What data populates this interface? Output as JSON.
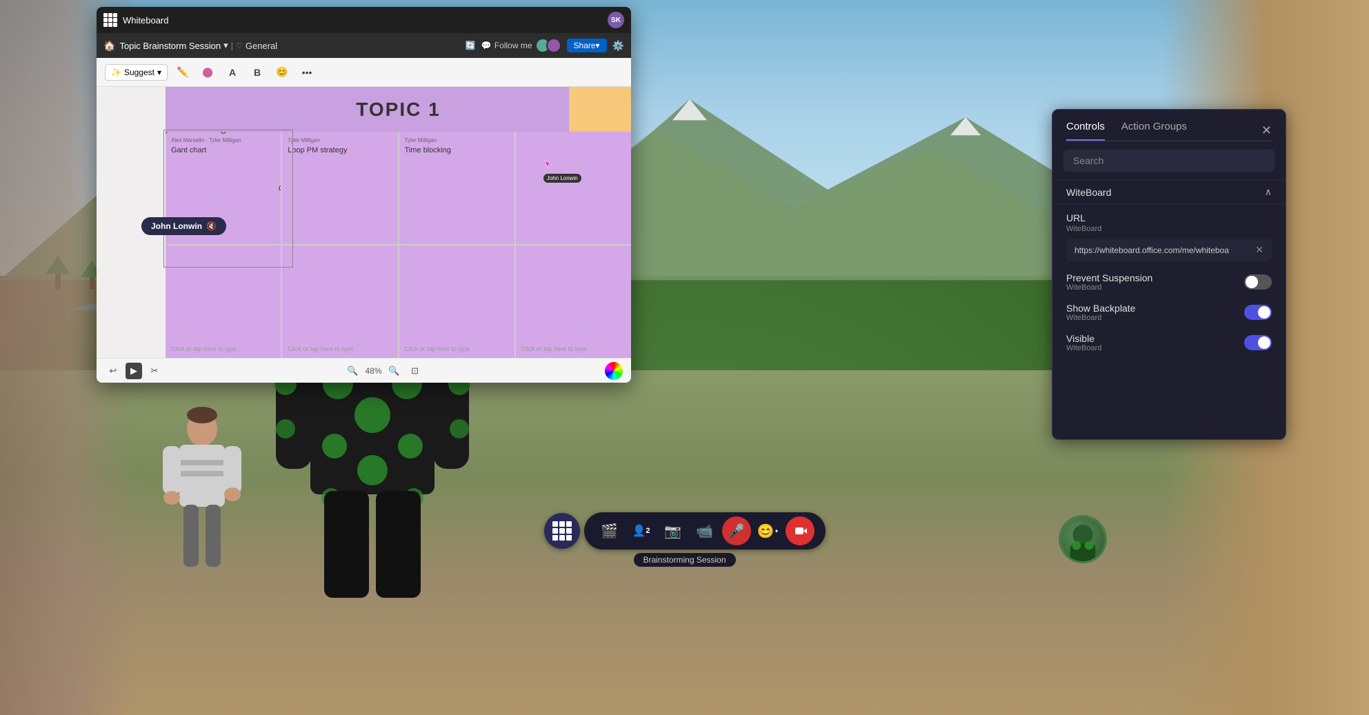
{
  "app": {
    "title": "Whiteboard"
  },
  "whiteboard": {
    "title": "Topic Brainstorm Session",
    "breadcrumb_home": "🏠",
    "breadcrumb_name": "Topic Brainstorm Session",
    "breadcrumb_channel": "General",
    "follow_label": "Follow me",
    "share_label": "Share▾",
    "sk_badge": "SK",
    "topic_title": "TOPIC 1",
    "zoom_level": "48%",
    "toolbar": {
      "suggest_label": "Suggest",
      "tools": [
        "✏️",
        "⬤",
        "A",
        "B",
        "😊",
        "•••"
      ]
    },
    "stickies": [
      {
        "author": "Alex Marsello · Tyler Milligan",
        "content": "Gant chart",
        "placeholder": ""
      },
      {
        "author": "Tyler Milligan",
        "content": "Loop PM strategy",
        "placeholder": ""
      },
      {
        "author": "Tyler Milligan",
        "content": "Time blocking",
        "placeholder": ""
      },
      {
        "author": "",
        "content": "",
        "placeholder": ""
      },
      {
        "author": "",
        "content": "",
        "placeholder": "Click or tap here to type"
      },
      {
        "author": "",
        "content": "",
        "placeholder": "Click or tap here to type"
      },
      {
        "author": "",
        "content": "",
        "placeholder": "Click or tap here to type"
      },
      {
        "author": "",
        "content": "",
        "placeholder": "Click or tap here to type"
      }
    ],
    "john_label": "John Lonwin",
    "john_cursor_label": "John Lonwin"
  },
  "controls_panel": {
    "tab_controls": "Controls",
    "tab_action_groups": "Action Groups",
    "search_placeholder": "Search",
    "section_title": "WiteBoard",
    "url_label": "URL",
    "url_sublabel": "WiteBoard",
    "url_value": "https://whiteboard.office.com/me/whiteboa",
    "prevent_suspension_label": "Prevent Suspension",
    "prevent_suspension_sublabel": "WiteBoard",
    "prevent_suspension_on": false,
    "show_backplate_label": "Show Backplate",
    "show_backplate_sublabel": "WiteBoard",
    "show_backplate_on": true,
    "visible_label": "Visible",
    "visible_sublabel": "WiteBoard"
  },
  "bottom_bar": {
    "grid_icon": "grid",
    "session_label": "Brainstorming Session",
    "buttons": [
      {
        "icon": "🎬",
        "label": "camera-btn"
      },
      {
        "icon": "👤2",
        "label": "people-btn"
      },
      {
        "icon": "📷",
        "label": "photo-btn"
      },
      {
        "icon": "📹",
        "label": "video-btn"
      },
      {
        "icon": "🎤",
        "label": "mic-btn"
      },
      {
        "icon": "😊",
        "label": "emoji-btn"
      }
    ],
    "record_btn": "⏺",
    "people_count": "2"
  }
}
